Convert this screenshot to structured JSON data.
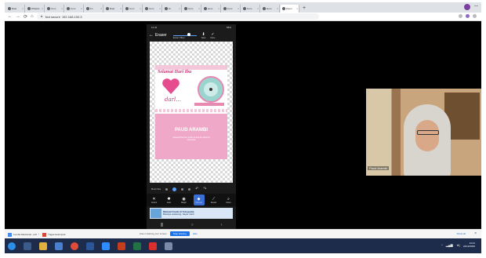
{
  "browser": {
    "tabs": [
      {
        "label": "Buat"
      },
      {
        "label": "WhatsA"
      },
      {
        "label": "Com"
      },
      {
        "label": "Com"
      },
      {
        "label": "Fn"
      },
      {
        "label": "Buat"
      },
      {
        "label": "Com"
      },
      {
        "label": "Com"
      },
      {
        "label": "Kl"
      },
      {
        "label": "Com"
      },
      {
        "label": "Hom"
      },
      {
        "label": "Com"
      },
      {
        "label": "Com"
      },
      {
        "label": "Hom"
      },
      {
        "label": "Zoom",
        "active": true
      }
    ],
    "new_tab": "+",
    "url_security": "Not secure",
    "url": "192.168.100.3"
  },
  "phone": {
    "status_time": "11:41",
    "status_right": "58%",
    "header": {
      "back": "←",
      "title": "Eraser",
      "slider_label": "Eraser Offset",
      "save_label": "Save",
      "done_label": "Done"
    },
    "card": {
      "title": "Selamat Hari Ibu",
      "cursive": "darl...",
      "school": "PAUD ARAMBI",
      "desc": "Selamat Hari Ibu untuk semua ibu hebat di Indonesia"
    },
    "brush_label": "Brush Size",
    "tools": [
      {
        "icon": "✕",
        "label": "Cutout"
      },
      {
        "icon": "✱",
        "label": "Auto"
      },
      {
        "icon": "◉",
        "label": "Magic"
      },
      {
        "icon": "◆",
        "label": "Manual",
        "selected": true
      },
      {
        "icon": "⟋",
        "label": "Repair"
      },
      {
        "icon": "⌕",
        "label": "Zoom"
      }
    ],
    "ad_title": "Nikmati Kredit di Tokopedia",
    "ad_sub": "Belanja sekarang, bayar nanti"
  },
  "webcam": {
    "name": "Paud Arambi"
  },
  "downloads": {
    "items": [
      {
        "label": "Lomba Mewarnai...pdf"
      },
      {
        "label": "Tugas Kelompok"
      }
    ],
    "sharing_msg": "Zoom sharing your screen",
    "stop_label": "Stop sharing",
    "hide_label": "Hide",
    "show_all": "Show all"
  },
  "taskbar": {
    "time": "14:41",
    "date": "22/12/2020"
  }
}
